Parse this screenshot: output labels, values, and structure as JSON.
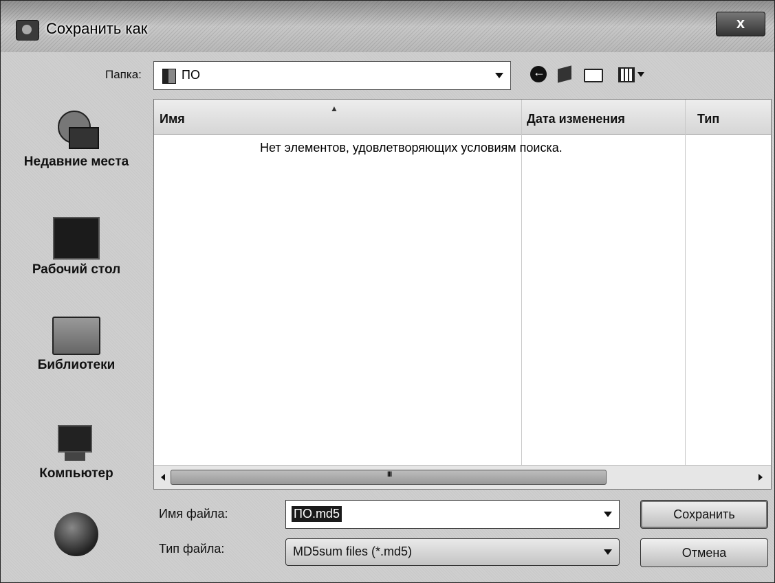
{
  "window": {
    "title": "Сохранить как",
    "close_label": "x"
  },
  "toolbar": {
    "folder_label": "Папка:",
    "folder_value": "ПО",
    "buttons": [
      "back-icon",
      "up-folder-icon",
      "new-folder-icon",
      "view-menu-icon"
    ]
  },
  "places": [
    {
      "label": "Недавние места",
      "icon": "recent-places-icon"
    },
    {
      "label": "Рабочий стол",
      "icon": "desktop-icon"
    },
    {
      "label": "Библиотеки",
      "icon": "libraries-icon"
    },
    {
      "label": "Компьютер",
      "icon": "computer-icon"
    },
    {
      "label": "",
      "icon": "network-icon"
    }
  ],
  "list": {
    "columns": [
      "Имя",
      "Дата изменения",
      "Тип"
    ],
    "empty_message": "Нет элементов, удовлетворяющих условиям поиска."
  },
  "form": {
    "filename_label": "Имя файла:",
    "filename_value": "ПО.md5",
    "filetype_label": "Тип файла:",
    "filetype_value": "MD5sum files (*.md5)"
  },
  "buttons": {
    "save": "Сохранить",
    "cancel": "Отмена"
  }
}
